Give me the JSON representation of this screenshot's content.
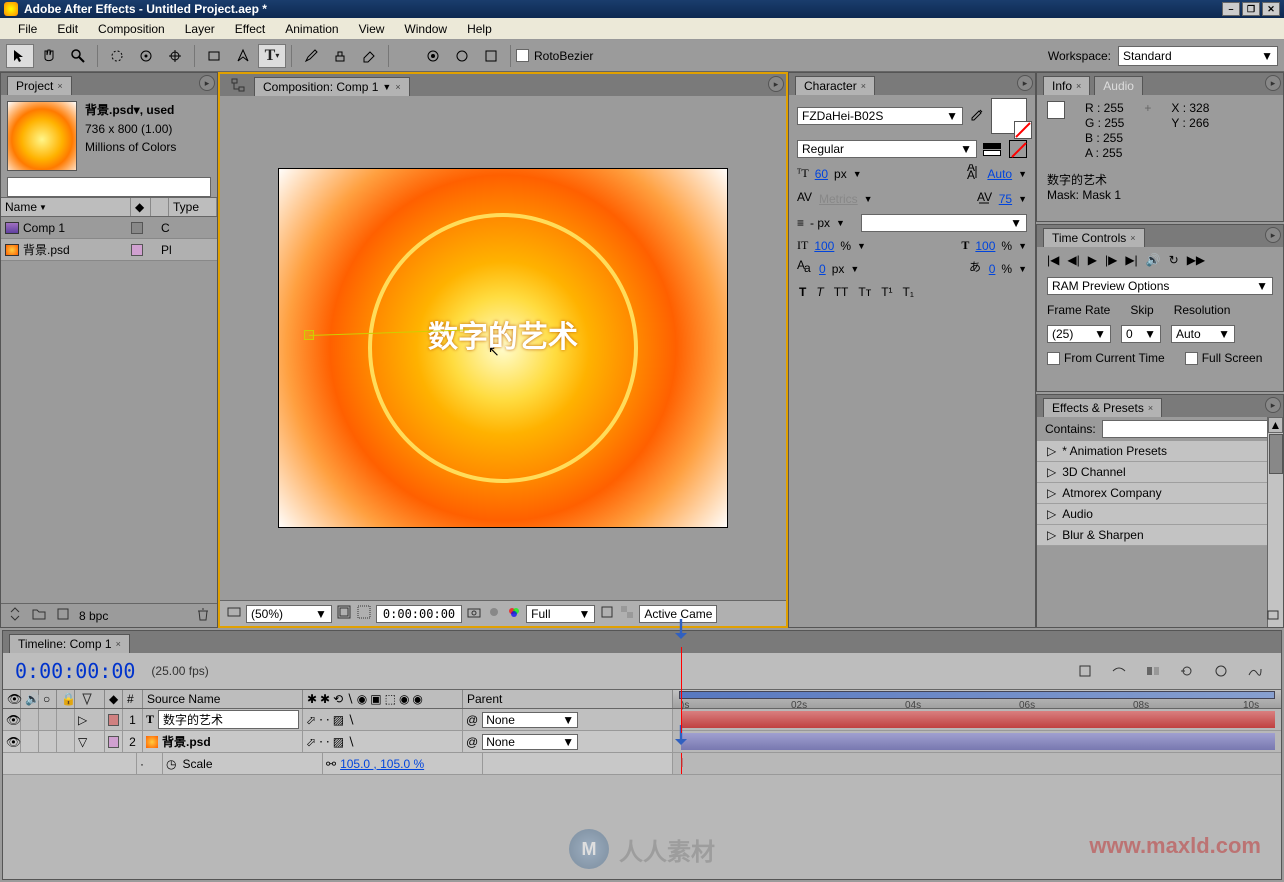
{
  "title": "Adobe After Effects - Untitled Project.aep *",
  "menu": [
    "File",
    "Edit",
    "Composition",
    "Layer",
    "Effect",
    "Animation",
    "View",
    "Window",
    "Help"
  ],
  "toolbar": {
    "rotoBezier": "RotoBezier",
    "workspaceLbl": "Workspace:",
    "workspace": "Standard"
  },
  "project": {
    "tab": "Project",
    "fname": "背景.psd▾, used",
    "dims": "736 x 800 (1.00)",
    "colors": "Millions of Colors",
    "cols": {
      "name": "Name",
      "type": "Type"
    },
    "items": [
      {
        "name": "Comp 1",
        "type": "C",
        "iconColor": "#888"
      },
      {
        "name": "背景.psd",
        "type": "Pl",
        "iconColor": "#d0a0d0"
      }
    ],
    "bpc": "8 bpc"
  },
  "comp": {
    "tab": "Composition: Comp 1",
    "canvasText": "数字的艺术",
    "zoom": "(50%)",
    "time": "0:00:00:00",
    "res": "Full",
    "camera": "Active Came"
  },
  "character": {
    "tab": "Character",
    "font": "FZDaHei-B02S",
    "style": "Regular",
    "size": "60",
    "sizeUnit": "px",
    "leading": "Auto",
    "kerning": "Metrics",
    "tracking": "75",
    "strokeUnit": "px",
    "strokeLabel": "- px",
    "vscale": "100",
    "vunit": "%",
    "hscale": "100",
    "hunit": "%",
    "baseline": "0",
    "baselineUnit": "px",
    "tsume": "0",
    "tsumeUnit": "%"
  },
  "info": {
    "tab": "Info",
    "tab2": "Audio",
    "r": "R :  255",
    "g": "G :  255",
    "b": "B :  255",
    "a": "A :  255",
    "x": "X : 328",
    "y": "Y : 266",
    "layer": "数字的艺术",
    "mask": "Mask: Mask 1"
  },
  "timeControls": {
    "tab": "Time Controls",
    "ram": "RAM Preview Options",
    "frameRateLbl": "Frame Rate",
    "frameRate": "(25)",
    "skipLbl": "Skip",
    "skip": "0",
    "resLbl": "Resolution",
    "res": "Auto",
    "chk1": "From Current Time",
    "chk2": "Full Screen"
  },
  "fx": {
    "tab": "Effects & Presets",
    "containsLbl": "Contains:",
    "items": [
      "* Animation Presets",
      "3D Channel",
      "Atmorex Company",
      "Audio",
      "Blur & Sharpen"
    ]
  },
  "timeline": {
    "tab": "Timeline: Comp 1",
    "time": "0:00:00:00",
    "fps": "(25.00 fps)",
    "cols": {
      "num": "#",
      "source": "Source Name",
      "parent": "Parent"
    },
    "ticks": [
      "0s",
      "02s",
      "04s",
      "06s",
      "08s",
      "10s"
    ],
    "layers": [
      {
        "num": "1",
        "name": "数字的艺术",
        "parent": "None",
        "type": "T",
        "color": "#d08080"
      },
      {
        "num": "2",
        "name": "背景.psd",
        "parent": "None",
        "type": "img",
        "color": "#d0a0d0"
      }
    ],
    "prop": "Scale",
    "propVal": "105.0 , 105.0 %"
  }
}
